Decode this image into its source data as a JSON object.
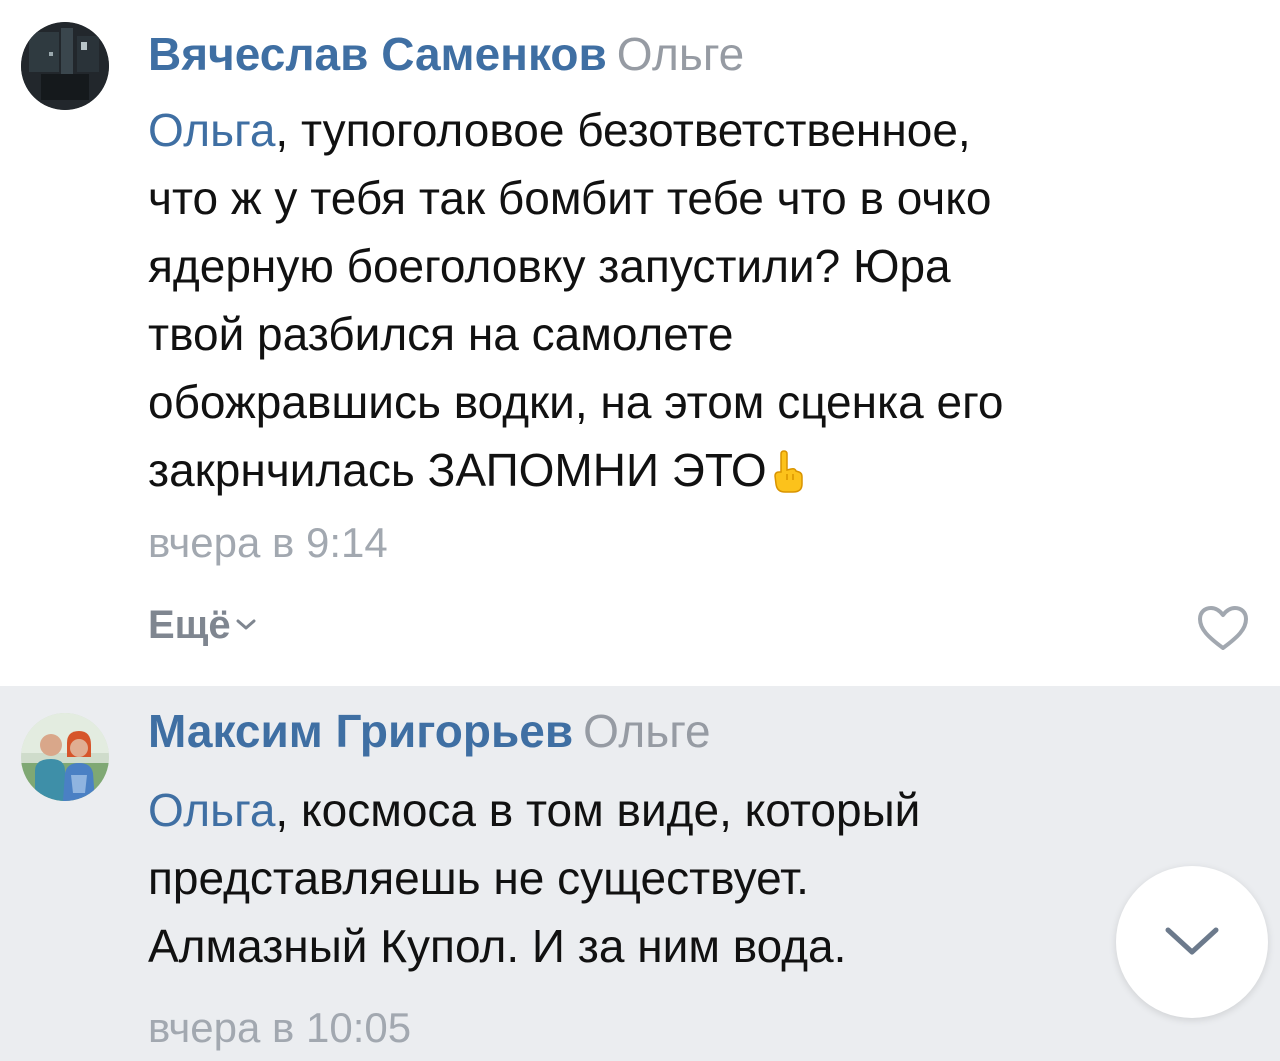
{
  "comments": [
    {
      "author": "Вячеслав Саменков",
      "reply_to": "Ольге",
      "mention": "Ольга",
      "text_lines": [
        ", тупоголовое безответственное,",
        "что ж у тебя так бомбит тебе что в очко",
        "ядерную боеголовку запустили? Юра",
        "твой разбился на самолете",
        "обожравшись водки, на этом сценка его",
        "закрнчилась ЗАПОМНИ ЭТО"
      ],
      "emoji": "pointing-up-icon",
      "timestamp": "вчера в 9:14",
      "more_label": "Ещё"
    },
    {
      "author": "Максим Григорьев",
      "reply_to": "Ольге",
      "mention": "Ольга",
      "text_lines": [
        ", космоса в том виде, который",
        "представляешь не существует.",
        "Алмазный Купол. И за ним вода."
      ],
      "timestamp": "вчера в 10:05"
    }
  ],
  "colors": {
    "author": "#3f6fa3",
    "secondary": "#969ba3",
    "highlight_bg": "#ebedf0"
  }
}
